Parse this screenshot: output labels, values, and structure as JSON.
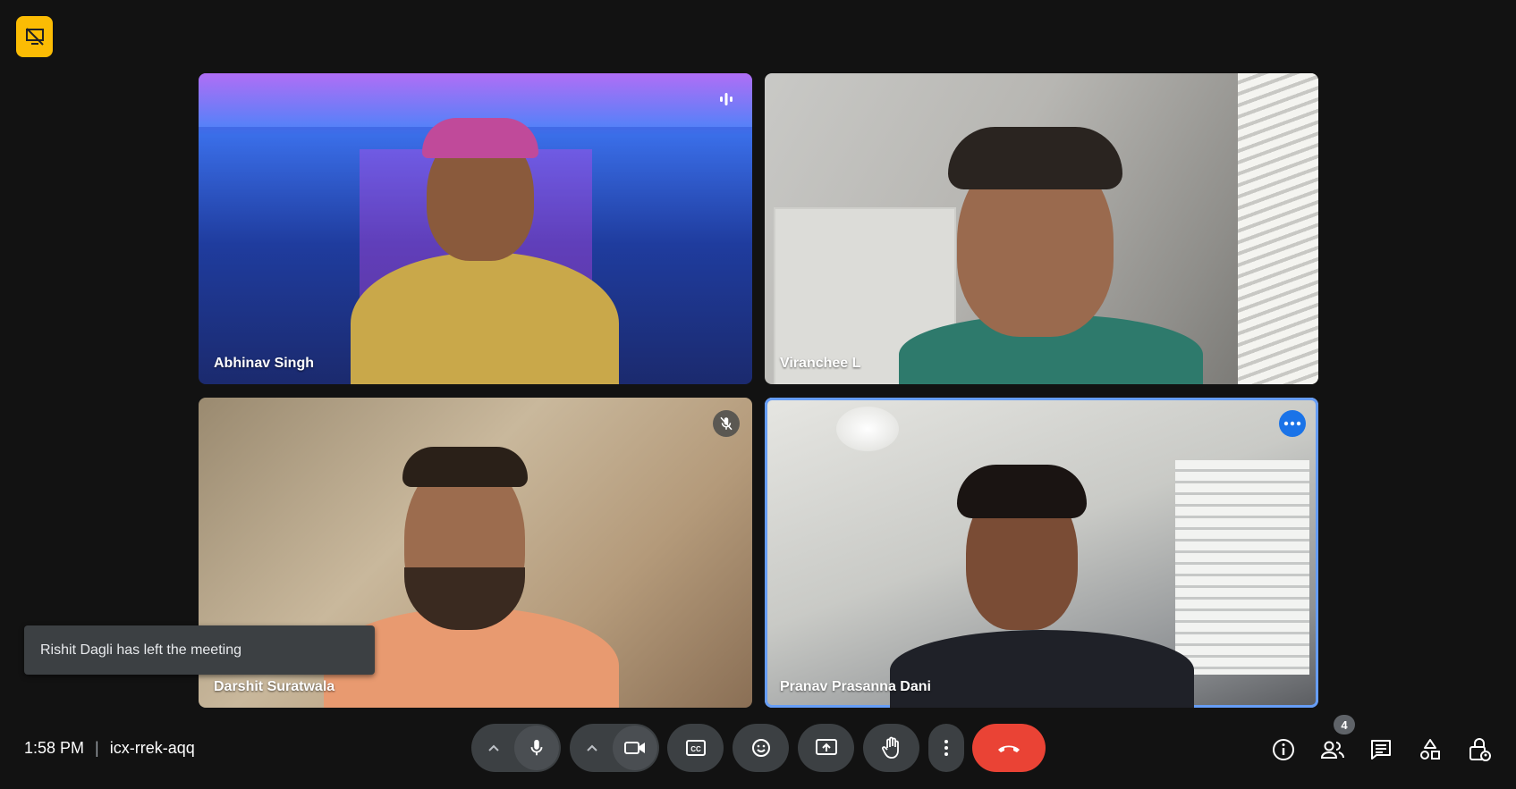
{
  "participants": [
    {
      "name": "Abhinav Singh",
      "status": "speaking"
    },
    {
      "name": "Viranchee L",
      "status": ""
    },
    {
      "name": "Darshit Suratwala",
      "status": "muted"
    },
    {
      "name": "Pranav Prasanna Dani",
      "status": "pinned-highlight"
    }
  ],
  "toast": {
    "message": "Rishit Dagli has left the meeting"
  },
  "meeting": {
    "time": "1:58 PM",
    "separator": "|",
    "code": "icx-rrek-aqq"
  },
  "participant_count": "4",
  "colors": {
    "end_call": "#ea4335",
    "highlight": "#669df6",
    "badge": "#fbbc04",
    "control_bg": "#3c4043"
  },
  "icons": [
    "presentation-off-icon",
    "audio-level-icon",
    "mic-off-icon",
    "more-options-icon",
    "chevron-up-icon",
    "mic-icon",
    "camera-icon",
    "captions-icon",
    "emoji-icon",
    "present-icon",
    "raise-hand-icon",
    "more-vert-icon",
    "end-call-icon",
    "info-icon",
    "people-icon",
    "chat-icon",
    "activities-icon",
    "host-controls-icon"
  ]
}
